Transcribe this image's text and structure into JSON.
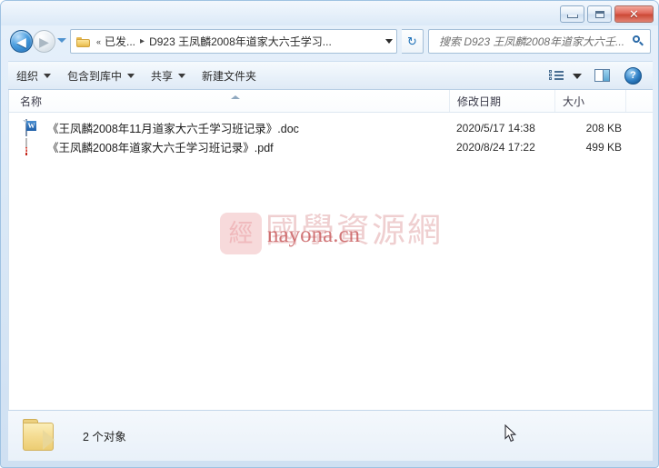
{
  "window": {
    "controls": {
      "minimize_label": "–",
      "maximize_label": "□",
      "close_label": "✕"
    }
  },
  "navigation": {
    "back_label": "◀",
    "forward_label": "▶",
    "history_dropdown_icon": "chevron-down-icon",
    "refresh_label": "↻"
  },
  "breadcrumb": {
    "folder_icon": "folder-icon",
    "overflow_chevrons": "«",
    "items": [
      {
        "label": "已发...",
        "separator": "▸"
      },
      {
        "label": "D923 王凤麟2008年道家大六壬学习...",
        "separator": ""
      }
    ],
    "dropdown_icon": "chevron-down-icon"
  },
  "search": {
    "placeholder": "搜索 D923 王凤麟2008年道家大六壬...",
    "value": "",
    "icon": "search-icon"
  },
  "toolbar": {
    "items": [
      {
        "label": "组织",
        "has_caret": true
      },
      {
        "label": "包含到库中",
        "has_caret": true
      },
      {
        "label": "共享",
        "has_caret": true
      },
      {
        "label": "新建文件夹",
        "has_caret": false
      }
    ],
    "view_icon": "list-view-icon",
    "view_caret_icon": "chevron-down-icon",
    "preview_pane_icon": "preview-pane-icon",
    "help_label": "?"
  },
  "file_list": {
    "columns": [
      "名称",
      "修改日期",
      "大小",
      ""
    ],
    "rows": [
      {
        "icon": "word-document-icon",
        "name": "《王凤麟2008年11月道家大六壬学习班记录》.doc",
        "date_modified": "2020/5/17 14:38",
        "size": "208 KB"
      },
      {
        "icon": "pdf-document-icon",
        "name": "《王凤麟2008年道家大六壬学习班记录》.pdf",
        "date_modified": "2020/8/24 17:22",
        "size": "499 KB"
      }
    ]
  },
  "watermark": {
    "logo_glyph": "經",
    "site_name_cn": "國學資源網",
    "site_url": "nayona.cn",
    "logo_color": "#f7dadb",
    "text_color": "#efcfd0",
    "url_color": "#c85a5c"
  },
  "status_bar": {
    "folder_icon": "folder-icon",
    "text": "2 个对象"
  }
}
